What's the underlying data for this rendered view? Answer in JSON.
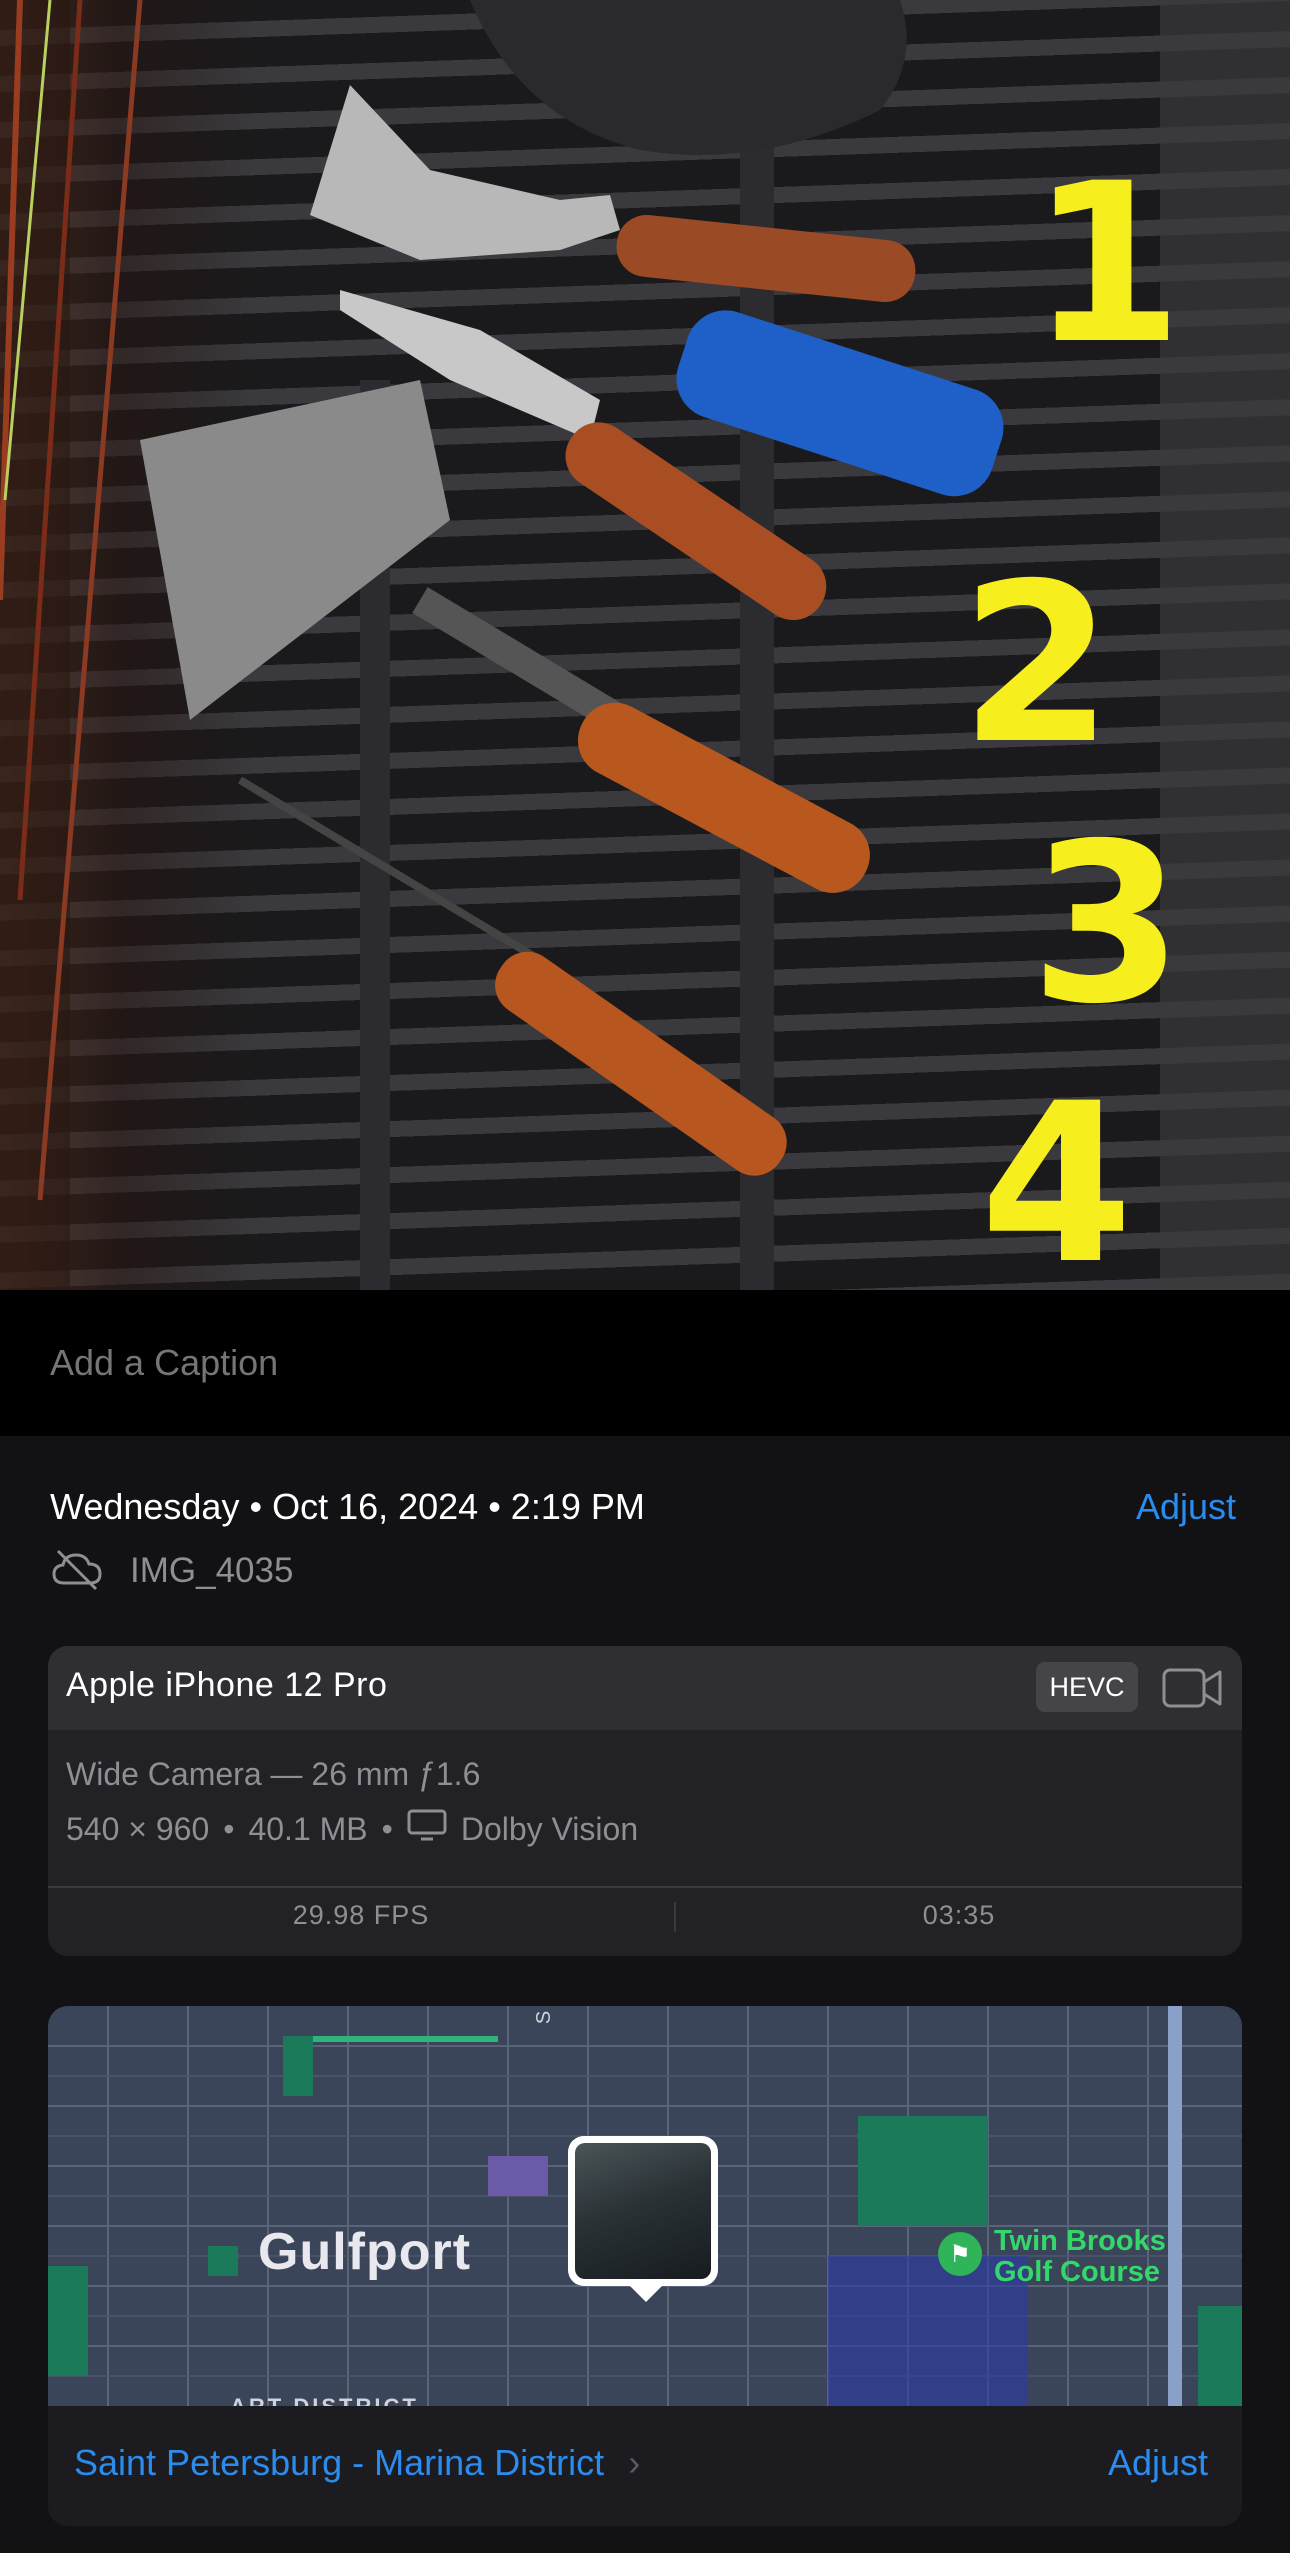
{
  "photo": {
    "annotation_numbers": [
      "1",
      "2",
      "3",
      "4"
    ]
  },
  "caption": {
    "placeholder": "Add a Caption"
  },
  "info": {
    "date_line": "Wednesday • Oct 16, 2024 • 2:19 PM",
    "adjust_label": "Adjust",
    "file_name": "IMG_4035",
    "cloud_icon": "cloud-off-icon"
  },
  "device": {
    "name": "Apple iPhone 12 Pro",
    "format_badge": "HEVC",
    "video_icon": "video-camera-icon",
    "lens": "Wide Camera — 26 mm ƒ1.6",
    "resolution": "540 × 960",
    "size": "40.1 MB",
    "hdr_icon": "display-icon",
    "hdr": "Dolby Vision",
    "fps": "29.98 FPS",
    "duration": "03:35"
  },
  "map": {
    "city_label": "Gulfport",
    "poi_line1": "Twin Brooks",
    "poi_line2": "Golf Course",
    "district_label": "ART DISTRICT",
    "road_label": "S",
    "location_name": "Saint Petersburg - Marina District",
    "adjust_label": "Adjust"
  },
  "colors": {
    "accent": "#2b8cf0",
    "annotation": "#f7ee1e",
    "golf": "#34d86a"
  }
}
